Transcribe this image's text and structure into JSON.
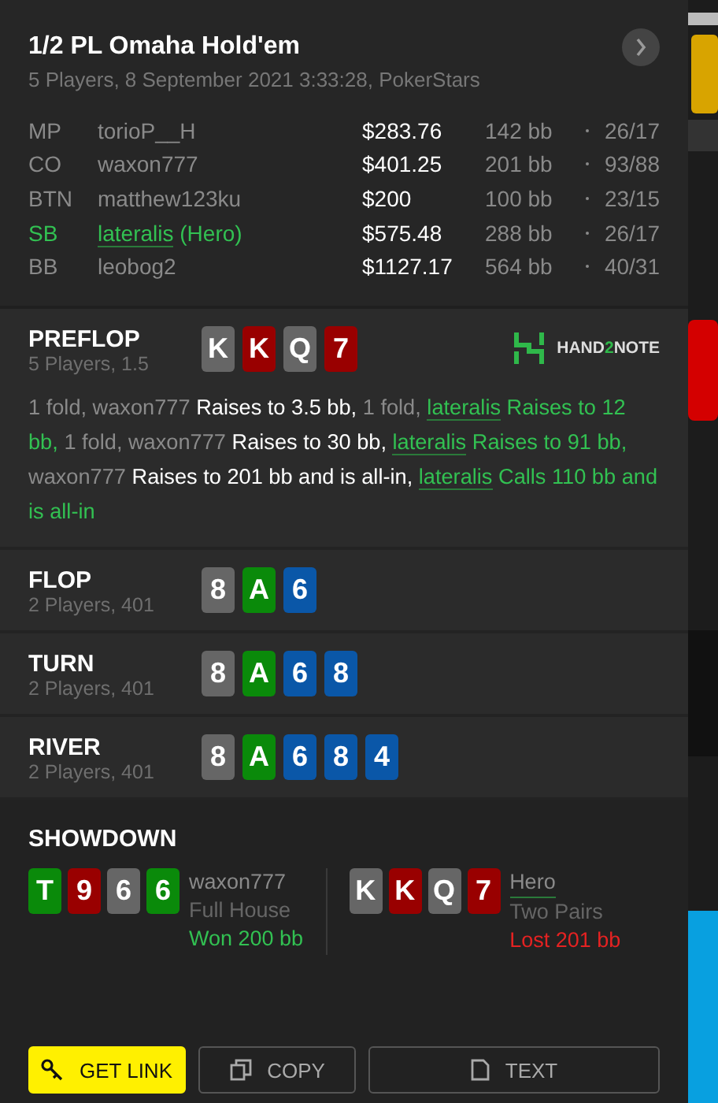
{
  "header": {
    "title": "1/2 PL Omaha Hold'em",
    "subtitle": "5 Players, 8 September 2021 3:33:28, PokerStars"
  },
  "players": [
    {
      "position": "MP",
      "name": "torioP__H",
      "hero": false,
      "stack": "$283.76",
      "bb": "142 bb",
      "stats": "26/17"
    },
    {
      "position": "CO",
      "name": "waxon777",
      "hero": false,
      "stack": "$401.25",
      "bb": "201 bb",
      "stats": "93/88"
    },
    {
      "position": "BTN",
      "name": "matthew123ku",
      "hero": false,
      "stack": "$200",
      "bb": "100 bb",
      "stats": "23/15"
    },
    {
      "position": "SB",
      "name": "lateralis",
      "hero_tag": "(Hero)",
      "hero": true,
      "stack": "$575.48",
      "bb": "288 bb",
      "stats": "26/17"
    },
    {
      "position": "BB",
      "name": "leobog2",
      "hero": false,
      "stack": "$1127.17",
      "bb": "564 bb",
      "stats": "40/31"
    }
  ],
  "streets": [
    {
      "name": "PREFLOP",
      "info": "5 Players, 1.5",
      "cards": [
        {
          "rank": "K",
          "color": "#666666"
        },
        {
          "rank": "K",
          "color": "#990000"
        },
        {
          "rank": "Q",
          "color": "#666666"
        },
        {
          "rank": "7",
          "color": "#990000"
        }
      ],
      "logo": [
        {
          "text": "HAND",
          "accent": false
        },
        {
          "text": "2",
          "accent": true
        },
        {
          "text": "NOTE",
          "accent": false
        }
      ],
      "actions": [
        {
          "text": "1 fold, waxon777 ",
          "kind": "muted"
        },
        {
          "text": "Raises to 3.5 bb, ",
          "kind": "action"
        },
        {
          "text": "1 fold, ",
          "kind": "muted"
        },
        {
          "text": "lateralis",
          "kind": "hero-name"
        },
        {
          "text": " Raises to 12 bb, ",
          "kind": "hero"
        },
        {
          "text": "1 fold, waxon777 ",
          "kind": "muted"
        },
        {
          "text": "Raises to 30 bb, ",
          "kind": "action"
        },
        {
          "text": "lateralis",
          "kind": "hero-name"
        },
        {
          "text": " Raises to 91 bb, ",
          "kind": "hero"
        },
        {
          "text": "waxon777 ",
          "kind": "muted"
        },
        {
          "text": "Raises to 201 bb and is all-in, ",
          "kind": "action"
        },
        {
          "text": "lateralis",
          "kind": "hero-name"
        },
        {
          "text": " Calls 110 bb and is all-in",
          "kind": "hero"
        }
      ]
    },
    {
      "name": "FLOP",
      "info": "2 Players, 401",
      "cards": [
        {
          "rank": "8",
          "color": "#666666"
        },
        {
          "rank": "A",
          "color": "#0a8a0a"
        },
        {
          "rank": "6",
          "color": "#0a57a8"
        }
      ]
    },
    {
      "name": "TURN",
      "info": "2 Players, 401",
      "cards": [
        {
          "rank": "8",
          "color": "#666666"
        },
        {
          "rank": "A",
          "color": "#0a8a0a"
        },
        {
          "rank": "6",
          "color": "#0a57a8"
        },
        {
          "rank": "8",
          "color": "#0a57a8"
        }
      ]
    },
    {
      "name": "RIVER",
      "info": "2 Players, 401",
      "cards": [
        {
          "rank": "8",
          "color": "#666666"
        },
        {
          "rank": "A",
          "color": "#0a8a0a"
        },
        {
          "rank": "6",
          "color": "#0a57a8"
        },
        {
          "rank": "8",
          "color": "#0a57a8"
        },
        {
          "rank": "4",
          "color": "#0a57a8"
        }
      ]
    }
  ],
  "showdown": {
    "title": "SHOWDOWN",
    "hands": [
      {
        "cards": [
          {
            "rank": "T",
            "color": "#0a8a0a"
          },
          {
            "rank": "9",
            "color": "#990000"
          },
          {
            "rank": "6",
            "color": "#666666"
          },
          {
            "rank": "6",
            "color": "#0a8a0a"
          }
        ],
        "player": "waxon777",
        "hero": false,
        "hand": "Full House",
        "result": "Won 200 bb",
        "won": true
      },
      {
        "cards": [
          {
            "rank": "K",
            "color": "#666666"
          },
          {
            "rank": "K",
            "color": "#990000"
          },
          {
            "rank": "Q",
            "color": "#666666"
          },
          {
            "rank": "7",
            "color": "#990000"
          }
        ],
        "player": "Hero",
        "hero": true,
        "hand": "Two Pairs",
        "result": "Lost 201 bb",
        "won": false
      }
    ]
  },
  "buttons": [
    {
      "label": "GET LINK",
      "kind": "primary"
    },
    {
      "label": "COPY",
      "kind": "copy"
    },
    {
      "label": "TEXT",
      "kind": "text"
    }
  ]
}
